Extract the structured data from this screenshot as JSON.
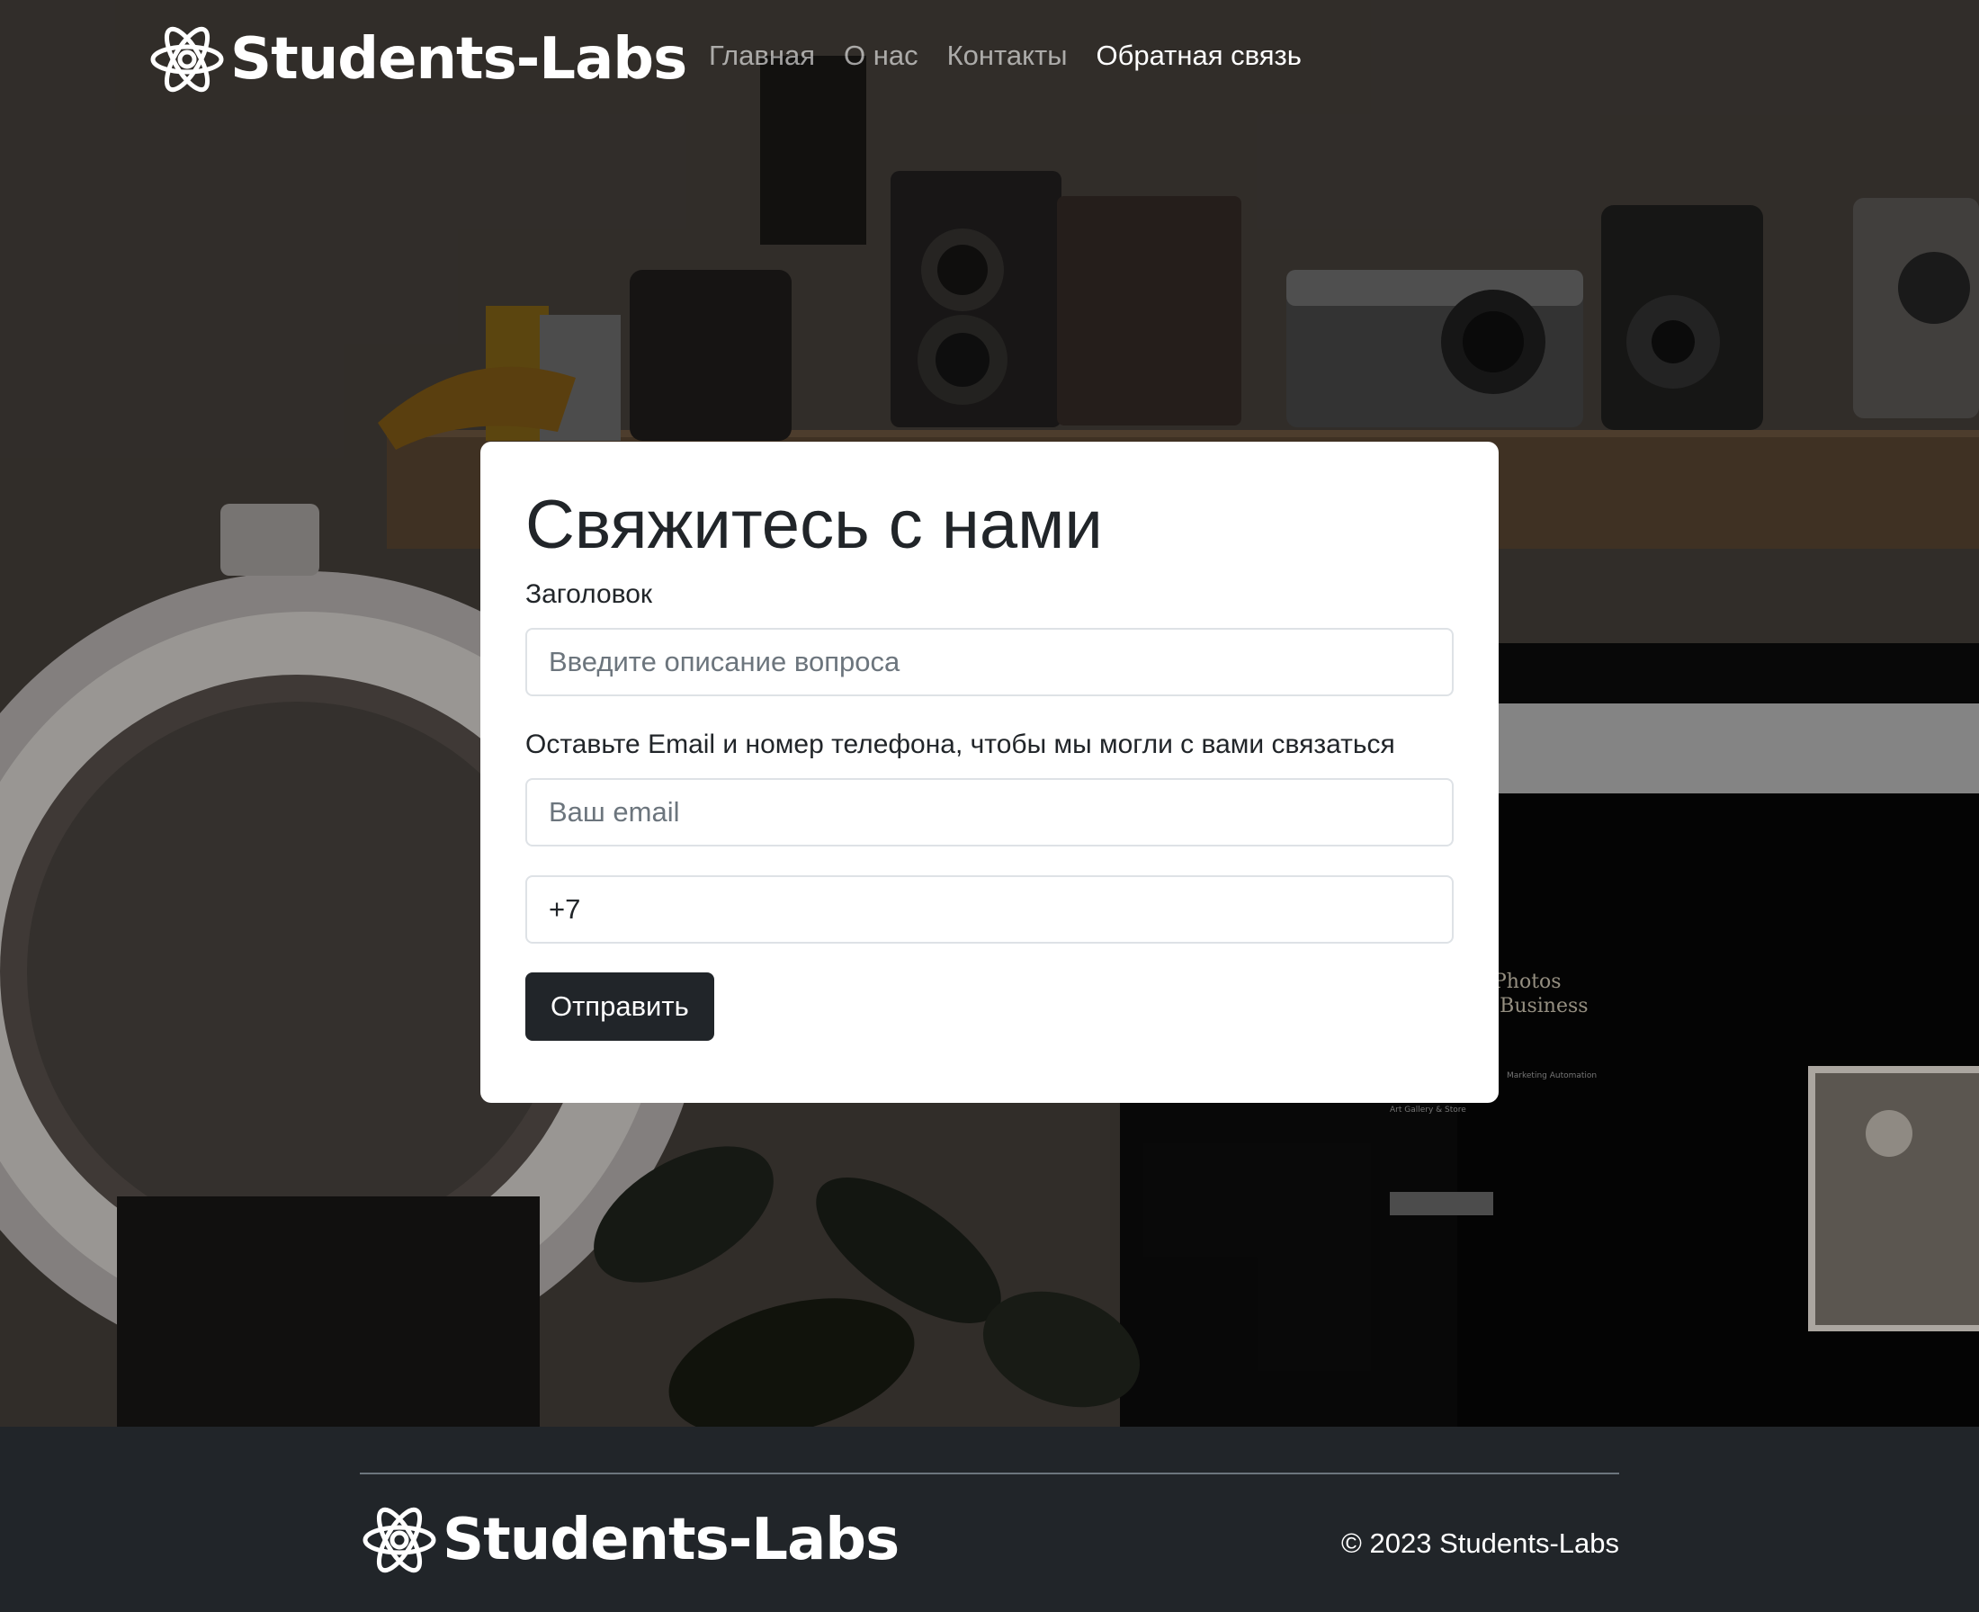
{
  "header": {
    "brand": "Students-Labs",
    "nav": [
      {
        "label": "Главная",
        "active": false
      },
      {
        "label": "О нас",
        "active": false
      },
      {
        "label": "Контакты",
        "active": false
      },
      {
        "label": "Обратная связь",
        "active": true
      }
    ]
  },
  "form": {
    "heading": "Свяжитесь с нами",
    "title_label": "Заголовок",
    "title_placeholder": "Введите описание вопроса",
    "contact_label": "Оставьте Email и номер телефона, чтобы мы могли с вами связаться",
    "email_placeholder": "Ваш email",
    "phone_value": "+7",
    "submit_label": "Отправить"
  },
  "background_text": {
    "line1": "Photos",
    "line2": "al Business",
    "small1": "Marketing Automation",
    "small2": "Art Gallery & Store"
  },
  "footer": {
    "brand": "Students-Labs",
    "copyright": "© 2023 Students-Labs"
  },
  "colors": {
    "dark": "#212529",
    "white": "#ffffff",
    "nav_muted": "rgba(255,255,255,0.6)"
  },
  "icons": {
    "logo": "atom-icon"
  }
}
